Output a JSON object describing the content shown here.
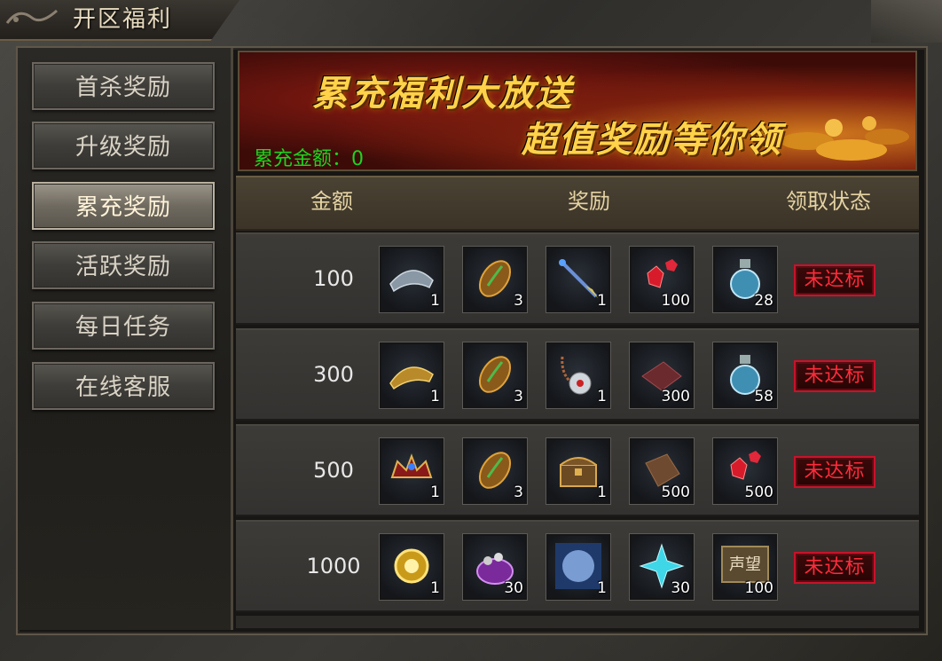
{
  "window": {
    "title": "开区福利"
  },
  "sidebar": {
    "items": [
      {
        "label": "首杀奖励",
        "active": false
      },
      {
        "label": "升级奖励",
        "active": false
      },
      {
        "label": "累充奖励",
        "active": true
      },
      {
        "label": "活跃奖励",
        "active": false
      },
      {
        "label": "每日任务",
        "active": false
      },
      {
        "label": "在线客服",
        "active": false
      }
    ]
  },
  "banner": {
    "line1": "累充福利大放送",
    "line2": "超值奖励等你领",
    "total_label": "累充金额：0"
  },
  "table": {
    "headers": {
      "amount": "金额",
      "reward": "奖励",
      "status": "领取状态"
    },
    "rows": [
      {
        "amount": "100",
        "status": "未达标",
        "items": [
          {
            "icon": "hat-icon",
            "count": "1"
          },
          {
            "icon": "jade-stone-icon",
            "count": "3"
          },
          {
            "icon": "dagger-icon",
            "count": "1"
          },
          {
            "icon": "red-gem-icon",
            "count": "100"
          },
          {
            "icon": "potion-icon",
            "count": "28"
          }
        ]
      },
      {
        "amount": "300",
        "status": "未达标",
        "items": [
          {
            "icon": "golden-hat-icon",
            "count": "1"
          },
          {
            "icon": "jade-stone-icon",
            "count": "3"
          },
          {
            "icon": "necklace-icon",
            "count": "1"
          },
          {
            "icon": "cloth-scroll-icon",
            "count": "300"
          },
          {
            "icon": "potion-icon",
            "count": "58"
          }
        ]
      },
      {
        "amount": "500",
        "status": "未达标",
        "items": [
          {
            "icon": "crown-icon",
            "count": "1"
          },
          {
            "icon": "jade-stone-icon",
            "count": "3"
          },
          {
            "icon": "treasure-chest-icon",
            "count": "1"
          },
          {
            "icon": "leather-icon",
            "count": "500"
          },
          {
            "icon": "red-gem-icon",
            "count": "500"
          }
        ]
      },
      {
        "amount": "1000",
        "status": "未达标",
        "items": [
          {
            "icon": "golden-emblem-icon",
            "count": "1"
          },
          {
            "icon": "jewel-pouch-icon",
            "count": "30"
          },
          {
            "icon": "ice-orb-icon",
            "count": "1"
          },
          {
            "icon": "crystal-star-icon",
            "count": "30"
          },
          {
            "icon": "prestige-plaque-icon",
            "count": "100",
            "plaque_text": "声望"
          }
        ]
      }
    ]
  },
  "colors": {
    "total_text": "#1fd21f",
    "status_red": "#ff2b3a",
    "header_text": "#e5d3a3",
    "banner_title": "#ffd24a"
  }
}
